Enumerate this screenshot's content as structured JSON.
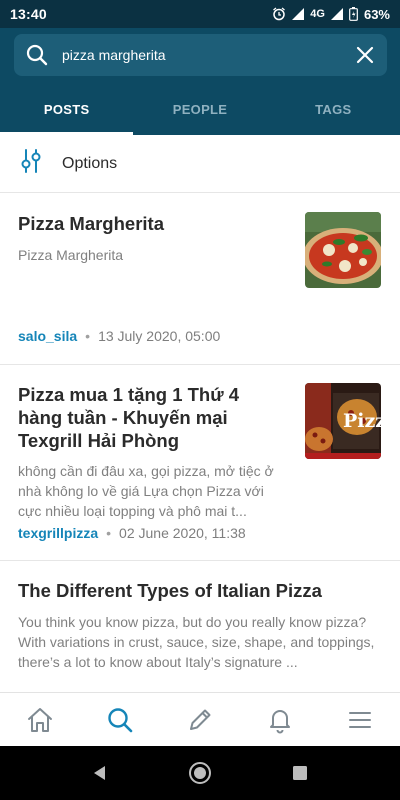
{
  "status_bar": {
    "time": "13:40",
    "network": "4G",
    "battery": "63%"
  },
  "search": {
    "query": "pizza margherita",
    "icon": "search-icon",
    "clear_icon": "close-icon"
  },
  "tabs": [
    {
      "label": "POSTS",
      "active": true
    },
    {
      "label": "PEOPLE",
      "active": false
    },
    {
      "label": "TAGS",
      "active": false
    }
  ],
  "options": {
    "label": "Options",
    "icon": "sliders-icon"
  },
  "posts": [
    {
      "title": "Pizza Margherita",
      "excerpt": "Pizza Margherita",
      "author": "salo_sila",
      "date": "13 July 2020, 05:00"
    },
    {
      "title": "Pizza mua 1 tặng 1 Thứ 4 hàng tuần - Khuyến mại Texgrill Hải Phòng",
      "excerpt": "không cần đi đâu xa, gọi pizza, mở tiệc ở nhà không lo về giá Lựa chọn Pizza với cực nhiều loại topping và phô mai t...",
      "author": "texgrillpizza",
      "date": "02 June 2020, 11:38",
      "thumb_text": "Pizza"
    },
    {
      "title": "The Different Types of Italian Pizza",
      "excerpt": "You think you know pizza, but do you really know pizza? With variations in crust, sauce, size, shape, and toppings, there’s a lot to know about Italy’s signature ..."
    }
  ],
  "bottom_nav": [
    "home-icon",
    "search-icon",
    "edit-icon",
    "bell-icon",
    "menu-icon"
  ],
  "colors": {
    "header": "#0d4a63",
    "status_bar": "#0b3142",
    "accent": "#1585b8"
  }
}
